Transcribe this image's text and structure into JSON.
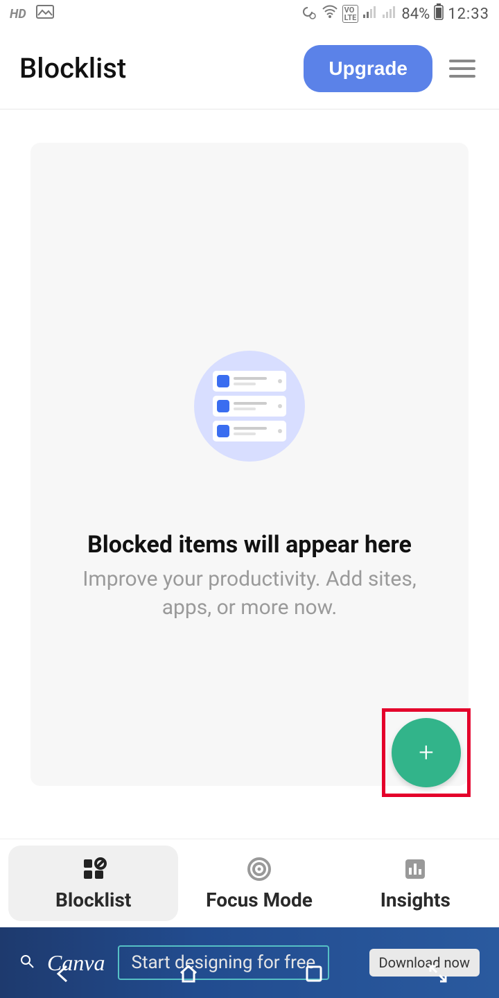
{
  "statusbar": {
    "hd": "HD",
    "battery": "84%",
    "time": "12:33"
  },
  "header": {
    "title": "Blocklist",
    "upgrade_label": "Upgrade"
  },
  "empty": {
    "title": "Blocked items will appear here",
    "subtitle": "Improve your productivity. Add sites, apps, or more now."
  },
  "fab": {
    "label": "+"
  },
  "nav": {
    "items": [
      {
        "label": "Blocklist"
      },
      {
        "label": "Focus Mode"
      },
      {
        "label": "Insights"
      }
    ]
  },
  "ad": {
    "brand": "Canva",
    "text": "Start designing for free",
    "cta": "Download now"
  }
}
